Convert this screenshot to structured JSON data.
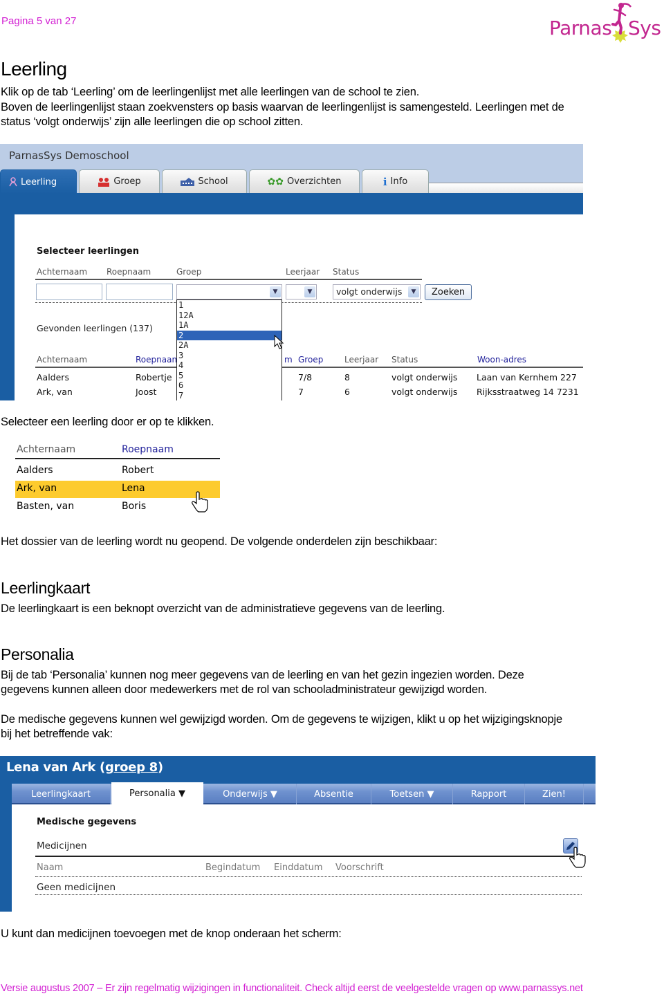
{
  "header": {
    "page_indicator": "Pagina 5 van 27",
    "logo_left": "Parnas",
    "logo_right": "Sys",
    "brand_color": "#d21fd2"
  },
  "section_leerling": {
    "title": "Leerling",
    "para1": "Klik op de tab ‘Leerling’ om de leerlingenlijst met alle leerlingen van de school te zien.",
    "para2": "Boven de leerlingenlijst staan zoekvensters op basis waarvan de leerlingenlijst is samengesteld. Leerlingen met de",
    "para3": "status ‘volgt onderwijs’ zijn alle leerlingen die op school zitten."
  },
  "screenshot1": {
    "app_title": "ParnasSys Demoschool",
    "tabs": [
      {
        "label": "Leerling",
        "icon": "person-icon",
        "active": true
      },
      {
        "label": "Groep",
        "icon": "group-icon",
        "active": false
      },
      {
        "label": "School",
        "icon": "school-icon",
        "active": false
      },
      {
        "label": "Overzichten",
        "icon": "gears-icon",
        "active": false
      },
      {
        "label": "Info",
        "icon": "info-icon",
        "active": false
      }
    ],
    "search": {
      "heading": "Selecteer leerlingen",
      "labels": {
        "achternaam": "Achternaam",
        "roepnaam": "Roepnaam",
        "groep": "Groep",
        "leerjaar": "Leerjaar",
        "status": "Status"
      },
      "achternaam_value": "",
      "roepnaam_value": "",
      "groep_value": "",
      "leerjaar_value": "",
      "status_value": "volgt onderwijs",
      "search_button": "Zoeken"
    },
    "groep_dropdown_options": [
      "1",
      "12A",
      "1A",
      "2",
      "2A",
      "3",
      "4",
      "5",
      "6",
      "7"
    ],
    "groep_dropdown_selected": "2",
    "found_label": "Gevonden leerlingen (137)",
    "table": {
      "headers": [
        "Achternaam",
        "Roepnaam",
        "m",
        "Groep",
        "Leerjaar",
        "Status",
        "Woon-adres"
      ],
      "rows": [
        {
          "achternaam": "Aalders",
          "roepnaam": "Robertje",
          "groep": "7/8",
          "leerjaar": "8",
          "status": "volgt onderwijs",
          "adres": "Laan van Kernhem 227"
        },
        {
          "achternaam": "Ark, van",
          "roepnaam": "Joost",
          "groep": "7",
          "leerjaar": "6",
          "status": "volgt onderwijs",
          "adres": "Rijksstraatweg 14 7231"
        }
      ]
    }
  },
  "instruction_select": "Selecteer een leerling door er op te klikken.",
  "snippet2": {
    "headers": [
      "Achternaam",
      "Roepnaam"
    ],
    "rows": [
      {
        "achternaam": "Aalders",
        "roepnaam": "Robert",
        "highlighted": false
      },
      {
        "achternaam": "Ark, van",
        "roepnaam": "Lena",
        "highlighted": true
      },
      {
        "achternaam": "Basten, van",
        "roepnaam": "Boris",
        "highlighted": false
      }
    ],
    "highlight_color": "#fdcb2e"
  },
  "dossier_intro": "Het dossier van de leerling wordt nu geopend. De volgende onderdelen zijn beschikbaar:",
  "section_leerlingkaart": {
    "title": "Leerlingkaart",
    "para": "De leerlingkaart is een beknopt overzicht van de administratieve gegevens van de leerling."
  },
  "section_personalia": {
    "title": "Personalia",
    "para1a": "Bij de tab ‘Personalia’ kunnen nog meer gegevens van de leerling en van het gezin ingezien worden. Deze",
    "para1b": "gegevens kunnen alleen door medewerkers met de rol van schooladministrateur gewijzigd worden.",
    "para2a": "De medische gegevens kunnen wel gewijzigd worden. Om de gegevens te wijzigen, klikt u op het wijzigingsknopje",
    "para2b": "bij het betreffende vak:"
  },
  "screenshot3": {
    "student_name": "Lena van Ark (",
    "group_link": "groep 8",
    "name_close": ")",
    "tabs": [
      {
        "label": "Leerlingkaart",
        "active": false
      },
      {
        "label": "Personalia ▼",
        "active": true
      },
      {
        "label": "Onderwijs ▼",
        "active": false
      },
      {
        "label": "Absentie",
        "active": false
      },
      {
        "label": "Toetsen ▼",
        "active": false
      },
      {
        "label": "Rapport",
        "active": false
      },
      {
        "label": "Zien!",
        "active": false
      }
    ],
    "section_heading": "Medische gegevens",
    "subsection": "Medicijnen",
    "columns": [
      "Naam",
      "Begindatum",
      "Einddatum",
      "Voorschrift"
    ],
    "empty_row": "Geen medicijnen"
  },
  "closing_text": "U kunt dan medicijnen toevoegen met de knop onderaan het scherm:",
  "footer": "Versie augustus 2007 – Er zijn regelmatig wijzigingen in functionaliteit. Check altijd eerst de veelgestelde vragen op www.parnassys.net"
}
